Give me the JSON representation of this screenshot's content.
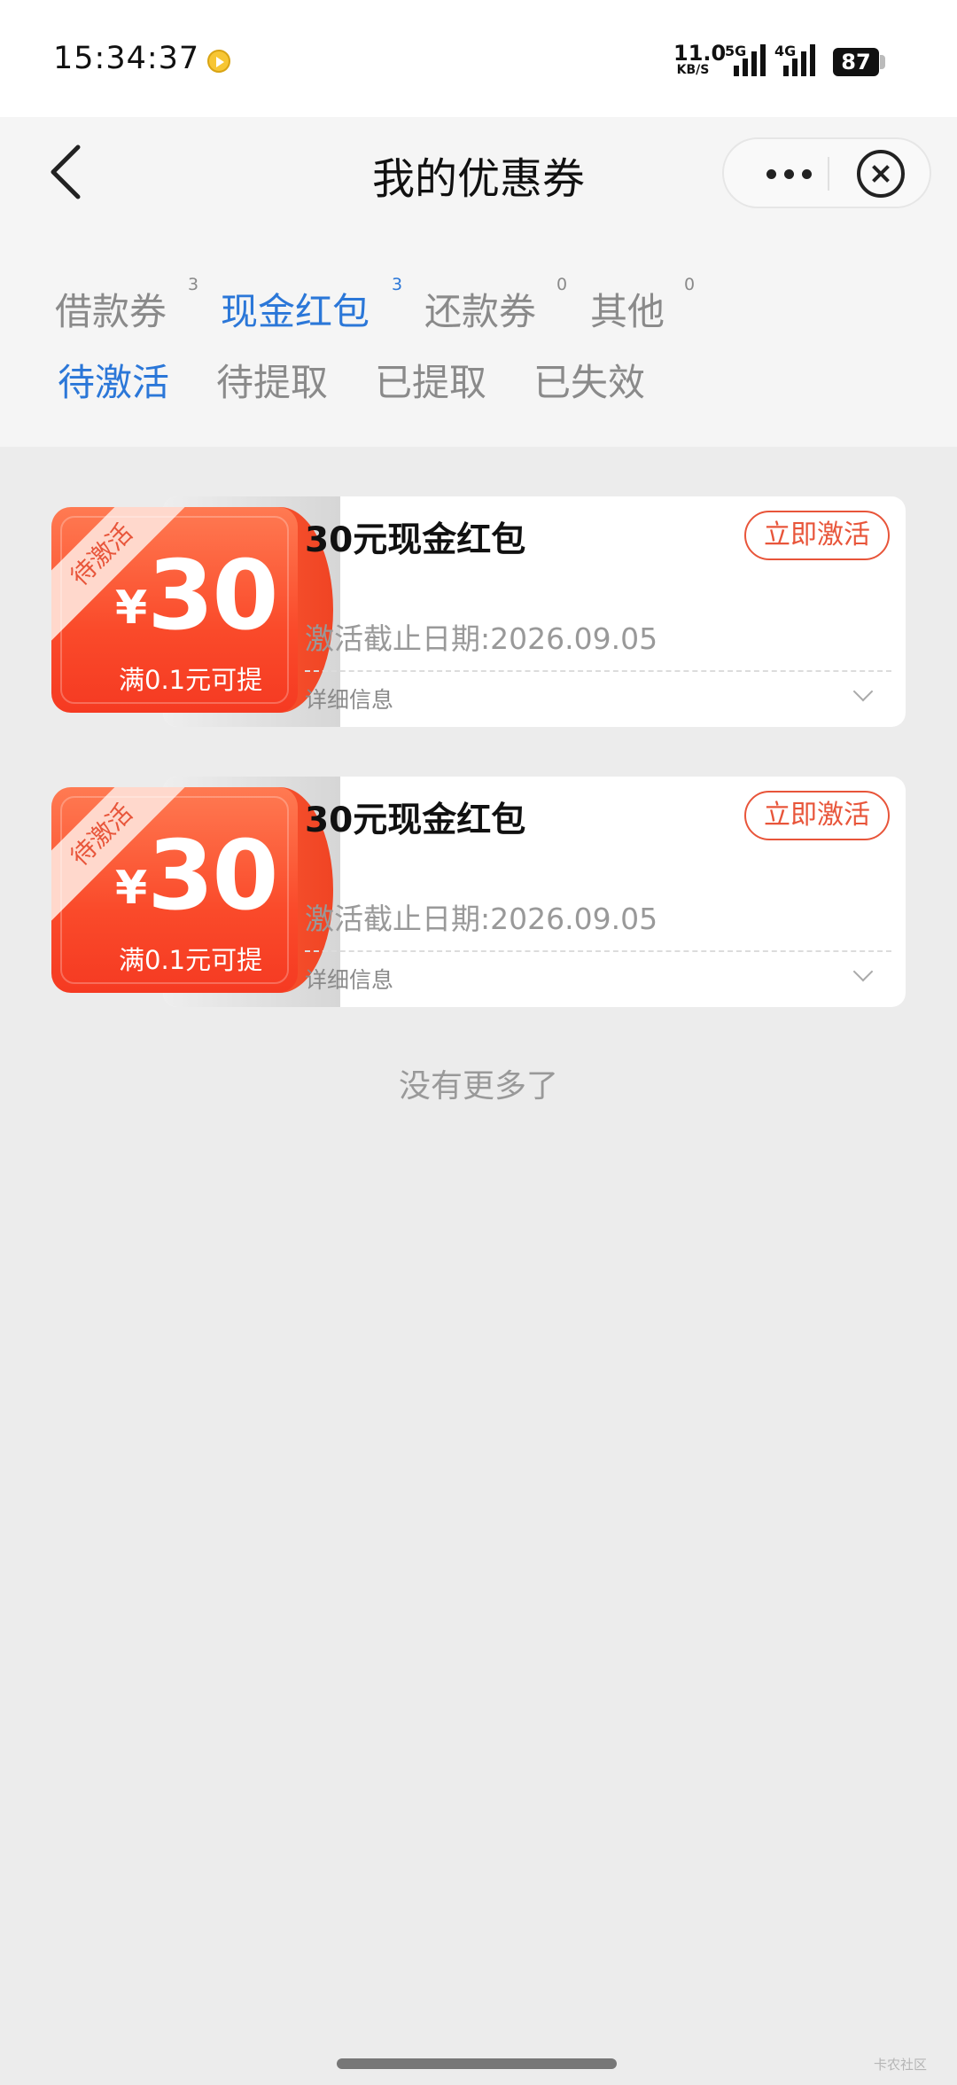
{
  "status_bar": {
    "time": "15:34:37",
    "net_speed_value": "11.0",
    "net_speed_unit": "KB/S",
    "sim1_label": "5G",
    "sim2_label": "4G",
    "battery": "87",
    "app_icon": "video-app-icon"
  },
  "header": {
    "title": "我的优惠券",
    "back_icon": "chevron-left-icon",
    "more_icon": "more-dots-icon",
    "close_icon": "close-circle-icon"
  },
  "tabs": [
    {
      "label": "借款券",
      "count": "3",
      "active": false
    },
    {
      "label": "现金红包",
      "count": "3",
      "active": true
    },
    {
      "label": "还款券",
      "count": "0",
      "active": false
    },
    {
      "label": "其他",
      "count": "0",
      "active": false
    }
  ],
  "subtabs": [
    {
      "label": "待激活",
      "active": true
    },
    {
      "label": "待提取",
      "active": false
    },
    {
      "label": "已提取",
      "active": false
    },
    {
      "label": "已失效",
      "active": false
    }
  ],
  "coupons": [
    {
      "ribbon": "待激活",
      "currency": "¥",
      "amount": "30",
      "threshold": "满0.1元可提",
      "title": "30元现金红包",
      "action": "立即激活",
      "deadline": "激活截止日期:2026.09.05",
      "detail": "详细信息"
    },
    {
      "ribbon": "待激活",
      "currency": "¥",
      "amount": "30",
      "threshold": "满0.1元可提",
      "title": "30元现金红包",
      "action": "立即激活",
      "deadline": "激活截止日期:2026.09.05",
      "detail": "详细信息"
    }
  ],
  "footer": {
    "no_more": "没有更多了",
    "watermark": "卡农社区"
  },
  "colors": {
    "accent_blue": "#2b77d8",
    "coupon_red": "#fa4a2a",
    "action_red": "#e8553a",
    "page_bg": "#ececec"
  }
}
